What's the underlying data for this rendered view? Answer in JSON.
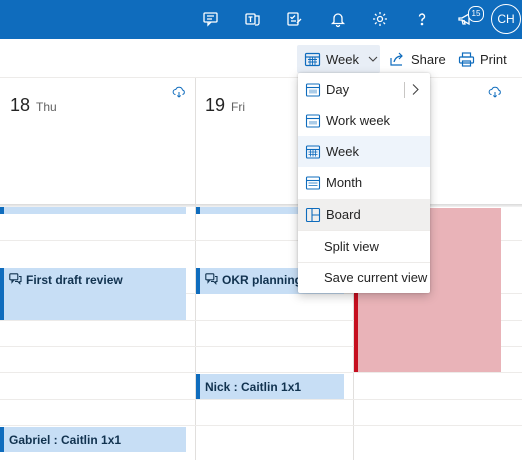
{
  "topbar": {
    "notifications_badge": "15",
    "avatar_initials": "CH",
    "icons": [
      "chat-icon",
      "teams-icon",
      "checklist-icon",
      "bell-icon",
      "gear-icon",
      "help-icon",
      "megaphone-icon"
    ]
  },
  "commandbar": {
    "view_label": "Week",
    "share_label": "Share",
    "print_label": "Print"
  },
  "days": [
    {
      "number": "18",
      "name": "Thu"
    },
    {
      "number": "19",
      "name": "Fri"
    }
  ],
  "events": [
    {
      "title": "First draft review"
    },
    {
      "title": "OKR planning"
    },
    {
      "title": "Nick : Caitlin 1x1"
    },
    {
      "title": "Gabriel : Caitlin 1x1"
    }
  ],
  "view_menu": {
    "items": [
      {
        "label": "Day",
        "icon": "calendar-day-icon"
      },
      {
        "label": "Work week",
        "icon": "calendar-workweek-icon"
      },
      {
        "label": "Week",
        "icon": "calendar-week-icon",
        "selected": true
      },
      {
        "label": "Month",
        "icon": "calendar-month-icon"
      },
      {
        "label": "Board",
        "icon": "board-icon"
      }
    ],
    "split_view_label": "Split view",
    "save_view_label": "Save current view"
  },
  "colors": {
    "brand": "#0f6cbd",
    "event_fill": "#c7def5",
    "busy_fill": "#e9b3b8",
    "busy_border": "#c50f1f"
  }
}
